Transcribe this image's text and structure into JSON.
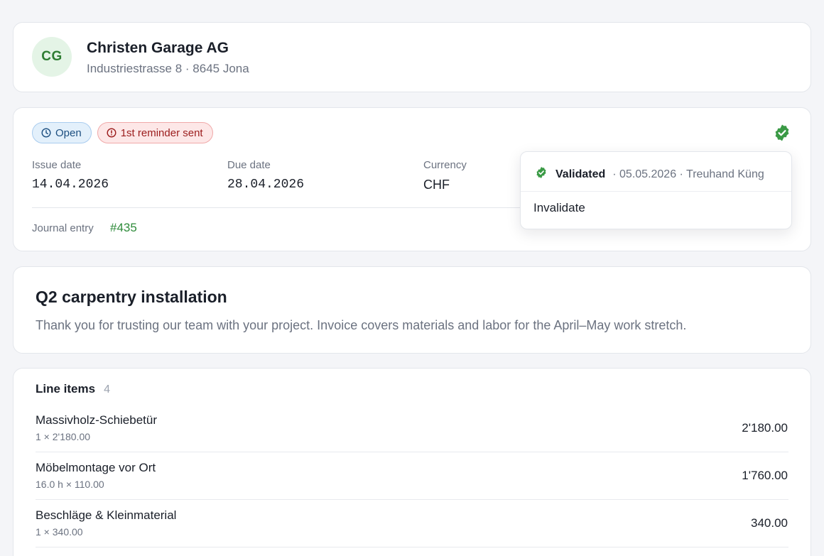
{
  "customer": {
    "initials": "CG",
    "name": "Christen Garage AG",
    "address": "Industriestrasse 8 · 8645 Jona"
  },
  "invoice": {
    "status_badge": "Open",
    "reminder_badge": "1st reminder sent",
    "fields": {
      "issue_date_label": "Issue date",
      "issue_date": "14.04.2026",
      "due_date_label": "Due date",
      "due_date": "28.04.2026",
      "currency_label": "Currency",
      "currency": "CHF"
    },
    "journal_label": "Journal entry",
    "journal_link": "#435"
  },
  "validation_popover": {
    "status": "Validated",
    "meta": "· 05.05.2026 · Treuhand Küng",
    "invalidate_label": "Invalidate"
  },
  "description": {
    "title": "Q2 carpentry installation",
    "text": "Thank you for trusting our team with your project. Invoice covers materials and labor for the April–May work stretch."
  },
  "line_items": {
    "title": "Line items",
    "count": "4",
    "items": [
      {
        "name": "Massivholz-Schiebetür",
        "qty": "1 × 2'180.00",
        "amount": "2'180.00"
      },
      {
        "name": "Möbelmontage vor Ort",
        "qty": "16.0 h × 110.00",
        "amount": "1'760.00"
      },
      {
        "name": "Beschläge & Kleinmaterial",
        "qty": "1 × 340.00",
        "amount": "340.00"
      }
    ]
  },
  "colors": {
    "accent_green": "#2e8b3a",
    "open_badge_bg": "#e3f0fb",
    "reminder_badge_bg": "#fde7e7"
  },
  "icons": {
    "open_badge": "clock-icon",
    "reminder_badge": "alert-circle-icon",
    "validated": "verified-seal-icon"
  }
}
